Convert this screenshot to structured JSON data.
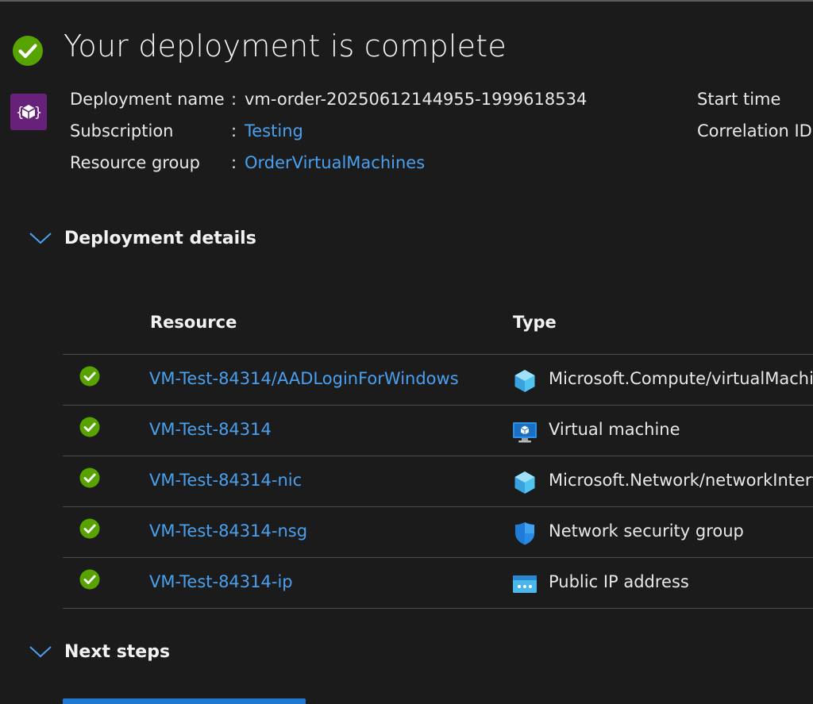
{
  "header": {
    "title": "Your deployment is complete",
    "status_icon": "success-check-icon"
  },
  "info": {
    "deployment_name_label": "Deployment name",
    "deployment_name_value": "vm-order-20250612144955-1999618534",
    "subscription_label": "Subscription",
    "subscription_value": "Testing",
    "resource_group_label": "Resource group",
    "resource_group_value": "OrderVirtualMachines",
    "start_time_label": "Start time",
    "correlation_id_label": "Correlation ID",
    "separator": ":"
  },
  "deployment_details": {
    "label": "Deployment details",
    "columns": {
      "resource": "Resource",
      "type": "Type"
    },
    "rows": [
      {
        "resource": "VM-Test-84314/AADLoginForWindows",
        "type": "Microsoft.Compute/virtualMachines/extensions",
        "icon": "cube-icon",
        "status": "success"
      },
      {
        "resource": "VM-Test-84314",
        "type": "Virtual machine",
        "icon": "virtual-machine-icon",
        "status": "success"
      },
      {
        "resource": "VM-Test-84314-nic",
        "type": "Microsoft.Network/networkInterfaces",
        "icon": "cube-icon",
        "status": "success"
      },
      {
        "resource": "VM-Test-84314-nsg",
        "type": "Network security group",
        "icon": "shield-icon",
        "status": "success"
      },
      {
        "resource": "VM-Test-84314-ip",
        "type": "Public IP address",
        "icon": "public-ip-icon",
        "status": "success"
      }
    ]
  },
  "next_steps": {
    "label": "Next steps"
  },
  "colors": {
    "background": "#1b1b1b",
    "link": "#4aa0f0",
    "success": "#57a300",
    "deploy_icon_bg": "#68217a",
    "primary_button": "#1f78d1"
  }
}
